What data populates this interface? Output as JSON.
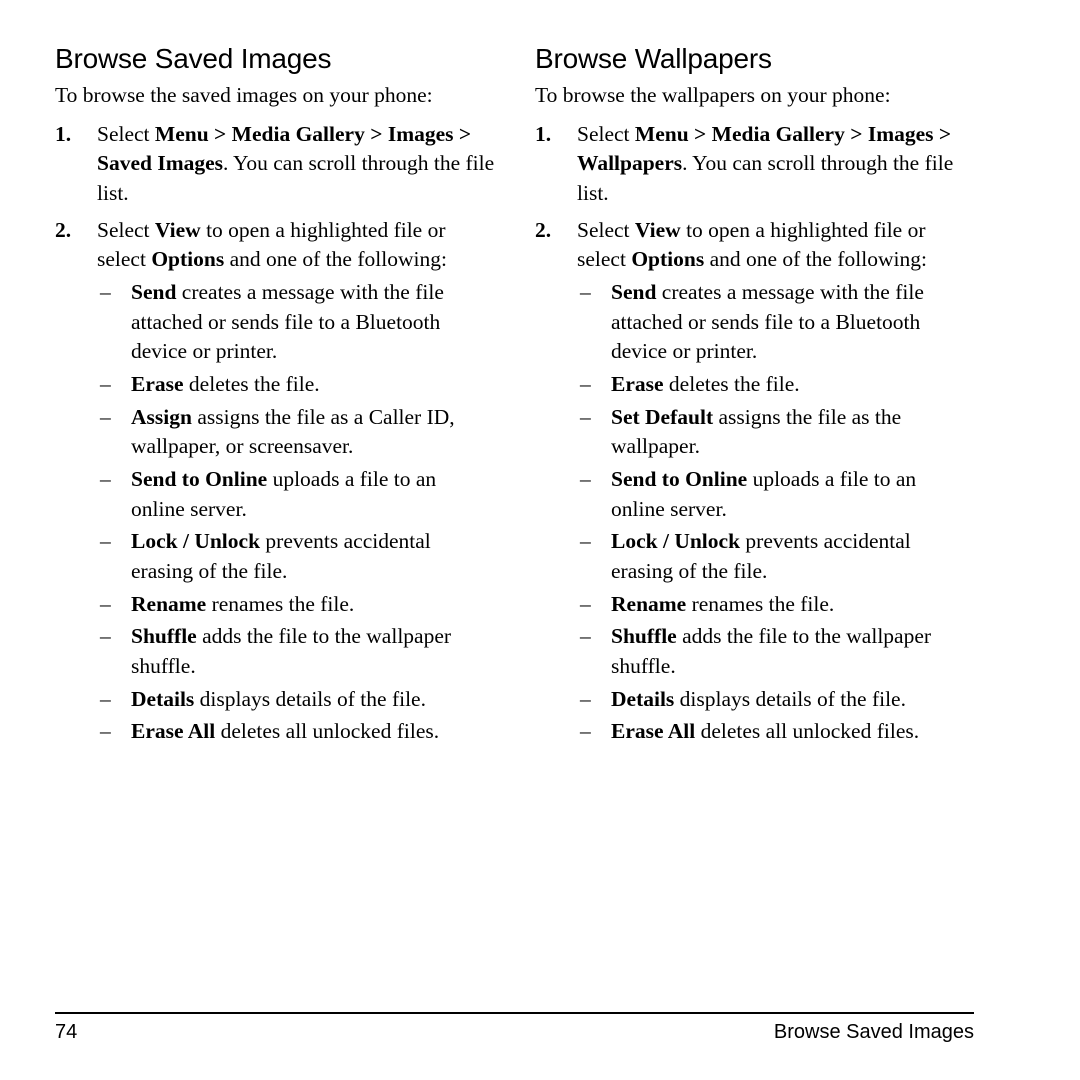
{
  "columns": [
    {
      "heading": "Browse Saved Images",
      "intro": "To browse the saved images on your phone:",
      "steps": [
        {
          "number": "1.",
          "parts": [
            {
              "text": "Select ",
              "bold": false
            },
            {
              "text": "Menu > Media Gallery > Images > Saved Images",
              "bold": true
            },
            {
              "text": ". You can scroll through the file list.",
              "bold": false
            }
          ]
        },
        {
          "number": "2.",
          "parts": [
            {
              "text": "Select ",
              "bold": false
            },
            {
              "text": "View",
              "bold": true
            },
            {
              "text": " to open a highlighted file or select ",
              "bold": false
            },
            {
              "text": "Options",
              "bold": true
            },
            {
              "text": " and one of the following:",
              "bold": false
            }
          ],
          "subitems": [
            {
              "marker": "–",
              "parts": [
                {
                  "text": "Send",
                  "bold": true
                },
                {
                  "text": " creates a message with the file attached or sends file to a Bluetooth device or printer.",
                  "bold": false
                }
              ]
            },
            {
              "marker": "–",
              "parts": [
                {
                  "text": "Erase",
                  "bold": true
                },
                {
                  "text": " deletes the file.",
                  "bold": false
                }
              ]
            },
            {
              "marker": "–",
              "parts": [
                {
                  "text": "Assign",
                  "bold": true
                },
                {
                  "text": " assigns the file as a Caller ID, wallpaper, or screensaver.",
                  "bold": false
                }
              ]
            },
            {
              "marker": "–",
              "parts": [
                {
                  "text": "Send to Online",
                  "bold": true
                },
                {
                  "text": " uploads a file to an online server.",
                  "bold": false
                }
              ]
            },
            {
              "marker": "–",
              "parts": [
                {
                  "text": "Lock / Unlock",
                  "bold": true
                },
                {
                  "text": " prevents accidental erasing of the file.",
                  "bold": false
                }
              ]
            },
            {
              "marker": "–",
              "parts": [
                {
                  "text": "Rename",
                  "bold": true
                },
                {
                  "text": " renames the file.",
                  "bold": false
                }
              ]
            },
            {
              "marker": "–",
              "parts": [
                {
                  "text": "Shuffle",
                  "bold": true
                },
                {
                  "text": " adds the file to the wallpaper shuffle.",
                  "bold": false
                }
              ]
            },
            {
              "marker": "–",
              "parts": [
                {
                  "text": "Details",
                  "bold": true
                },
                {
                  "text": " displays details of the file.",
                  "bold": false
                }
              ]
            },
            {
              "marker": "–",
              "parts": [
                {
                  "text": "Erase All",
                  "bold": true
                },
                {
                  "text": " deletes all unlocked files.",
                  "bold": false
                }
              ]
            }
          ]
        }
      ]
    },
    {
      "heading": "Browse Wallpapers",
      "intro": "To browse the wallpapers on your phone:",
      "steps": [
        {
          "number": "1.",
          "parts": [
            {
              "text": "Select ",
              "bold": false
            },
            {
              "text": "Menu > Media Gallery > Images > Wallpapers",
              "bold": true
            },
            {
              "text": ". You can scroll through the file list.",
              "bold": false
            }
          ]
        },
        {
          "number": "2.",
          "parts": [
            {
              "text": "Select ",
              "bold": false
            },
            {
              "text": "View",
              "bold": true
            },
            {
              "text": " to open a highlighted file or select ",
              "bold": false
            },
            {
              "text": "Options",
              "bold": true
            },
            {
              "text": " and one of the following:",
              "bold": false
            }
          ],
          "subitems": [
            {
              "marker": "–",
              "parts": [
                {
                  "text": "Send",
                  "bold": true
                },
                {
                  "text": " creates a message with the file attached or sends file to a Bluetooth device or printer.",
                  "bold": false
                }
              ]
            },
            {
              "marker": "–",
              "parts": [
                {
                  "text": "Erase",
                  "bold": true
                },
                {
                  "text": " deletes the file.",
                  "bold": false
                }
              ]
            },
            {
              "marker": "–",
              "parts": [
                {
                  "text": "Set Default",
                  "bold": true
                },
                {
                  "text": " assigns the file as the wallpaper.",
                  "bold": false
                }
              ]
            },
            {
              "marker": "–",
              "parts": [
                {
                  "text": "Send to Online",
                  "bold": true
                },
                {
                  "text": " uploads a file to an online server.",
                  "bold": false
                }
              ]
            },
            {
              "marker": "–",
              "parts": [
                {
                  "text": "Lock / Unlock",
                  "bold": true
                },
                {
                  "text": " prevents accidental erasing of the file.",
                  "bold": false
                }
              ]
            },
            {
              "marker": "–",
              "parts": [
                {
                  "text": "Rename",
                  "bold": true
                },
                {
                  "text": " renames the file.",
                  "bold": false
                }
              ]
            },
            {
              "marker": "–",
              "parts": [
                {
                  "text": "Shuffle",
                  "bold": true
                },
                {
                  "text": " adds the file to the wallpaper shuffle.",
                  "bold": false
                }
              ]
            },
            {
              "marker": "–",
              "parts": [
                {
                  "text": "Details",
                  "bold": true
                },
                {
                  "text": " displays details of the file.",
                  "bold": false
                }
              ]
            },
            {
              "marker": "–",
              "parts": [
                {
                  "text": "Erase All",
                  "bold": true
                },
                {
                  "text": " deletes all unlocked files.",
                  "bold": false
                }
              ]
            }
          ]
        }
      ]
    }
  ],
  "footer": {
    "page_number": "74",
    "running_head": "Browse Saved Images"
  }
}
